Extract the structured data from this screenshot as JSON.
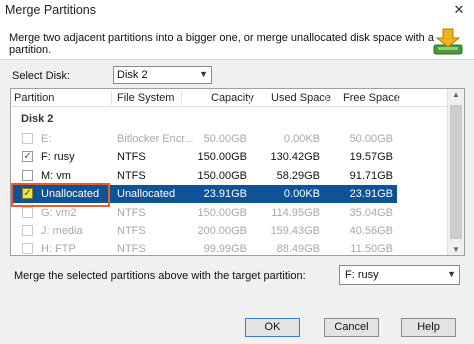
{
  "window": {
    "title": "Merge Partitions",
    "close_glyph": "✕"
  },
  "header": {
    "description": "Merge two adjacent partitions into a bigger one, or merge unallocated disk space with a partition.",
    "logo_icon": "merge-arrow-icon"
  },
  "disk_selector": {
    "label": "Select Disk:",
    "value": "Disk 2"
  },
  "table": {
    "columns": [
      "Partition",
      "File System",
      "Capacity",
      "Used Space",
      "Free Space"
    ],
    "group": "Disk 2",
    "rows": [
      {
        "partition": "E:",
        "file_system": "Bitlocker Encr...",
        "capacity": "50.00GB",
        "used": "0.00KB",
        "free": "50.00GB",
        "checked": false,
        "disabled": true,
        "selected": false
      },
      {
        "partition": "F: rusy",
        "file_system": "NTFS",
        "capacity": "150.00GB",
        "used": "130.42GB",
        "free": "19.57GB",
        "checked": true,
        "disabled": false,
        "selected": false
      },
      {
        "partition": "M: vm",
        "file_system": "NTFS",
        "capacity": "150.00GB",
        "used": "58.29GB",
        "free": "91.71GB",
        "checked": false,
        "disabled": false,
        "selected": false
      },
      {
        "partition": "Unallocated",
        "file_system": "Unallocated",
        "capacity": "23.91GB",
        "used": "0.00KB",
        "free": "23.91GB",
        "checked": true,
        "disabled": false,
        "selected": true
      },
      {
        "partition": "G: vm2",
        "file_system": "NTFS",
        "capacity": "150.00GB",
        "used": "114.95GB",
        "free": "35.04GB",
        "checked": false,
        "disabled": true,
        "selected": false
      },
      {
        "partition": "J: media",
        "file_system": "NTFS",
        "capacity": "200.00GB",
        "used": "159.43GB",
        "free": "40.56GB",
        "checked": false,
        "disabled": true,
        "selected": false
      },
      {
        "partition": "H: FTP",
        "file_system": "NTFS",
        "capacity": "99.99GB",
        "used": "88.49GB",
        "free": "11.50GB",
        "checked": false,
        "disabled": true,
        "selected": false
      }
    ]
  },
  "merge_target": {
    "label": "Merge the selected partitions above with the target partition:",
    "value": "F: rusy"
  },
  "buttons": {
    "ok": "OK",
    "cancel": "Cancel",
    "help": "Help"
  },
  "colors": {
    "selection": "#0f5296",
    "highlight_box": "#e85d2a",
    "check": "#1a8a1a"
  }
}
